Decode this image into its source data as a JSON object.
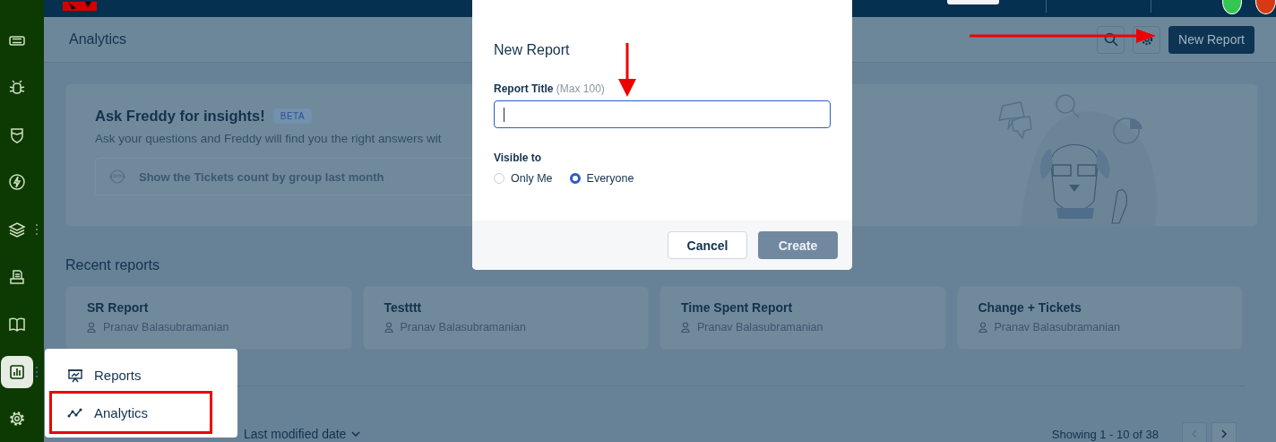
{
  "sidebar": {
    "items": [
      {
        "kind": "ticket",
        "selected": false,
        "more": false
      },
      {
        "kind": "bug",
        "selected": false,
        "more": false
      },
      {
        "kind": "shield",
        "selected": false,
        "more": false
      },
      {
        "kind": "bolt",
        "selected": false,
        "more": false
      },
      {
        "kind": "layers",
        "selected": false,
        "more": true
      },
      {
        "kind": "inbox",
        "selected": false,
        "more": false
      },
      {
        "kind": "book",
        "selected": false,
        "more": false
      },
      {
        "kind": "chart",
        "selected": true,
        "more": true
      },
      {
        "kind": "gear",
        "selected": false,
        "more": false
      }
    ]
  },
  "page": {
    "title": "Analytics",
    "new_button": "New Report"
  },
  "freddy_card": {
    "title": "Ask Freddy for insights!",
    "badge": "BETA",
    "description": "Ask your questions and Freddy will find you the right answers wit",
    "placeholder": "Show the Tickets count by group last month"
  },
  "recent_reports": {
    "heading": "Recent reports",
    "items": [
      {
        "title": "SR Report",
        "owner": "Pranav Balasubramanian"
      },
      {
        "title": "Testttt",
        "owner": "Pranav Balasubramanian"
      },
      {
        "title": "Time Spent Report",
        "owner": "Pranav Balasubramanian"
      },
      {
        "title": "Change + Tickets",
        "owner": "Pranav Balasubramanian"
      }
    ]
  },
  "list_toolbar": {
    "sort_value": "Last modified date",
    "pagination": "Showing 1 - 10 of 38"
  },
  "menu": {
    "items": [
      {
        "kind": "reports",
        "label": "Reports",
        "annotated": false
      },
      {
        "kind": "analytics",
        "label": "Analytics",
        "annotated": true
      }
    ]
  },
  "dialog": {
    "title": "New Report",
    "field": {
      "label": "Report Title",
      "hint": "(Max 100)",
      "focused": true
    },
    "visibility": {
      "label": "Visible to",
      "options": [
        {
          "label": "Only Me",
          "selected": false
        },
        {
          "label": "Everyone",
          "selected": true
        }
      ]
    },
    "buttons": [
      {
        "kind": "secondary",
        "label": "Cancel",
        "disabled": false
      },
      {
        "kind": "primary",
        "label": "Create",
        "disabled": true
      }
    ]
  },
  "annotations": {
    "settings_arrow": true,
    "title_field_arrow": true
  }
}
